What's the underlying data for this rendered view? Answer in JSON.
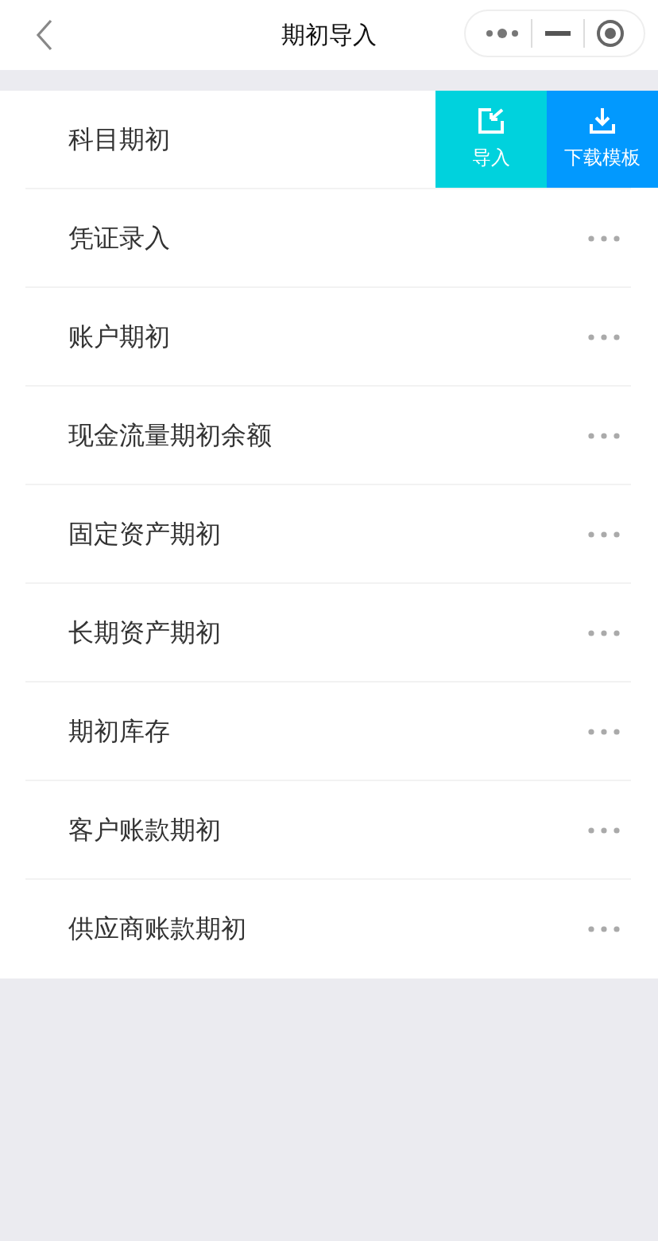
{
  "nav": {
    "title": "期初导入"
  },
  "items": [
    {
      "label": "科目期初",
      "swiped": true,
      "actions": [
        {
          "label": "导入",
          "kind": "import"
        },
        {
          "label": "下载模板",
          "kind": "download"
        }
      ]
    },
    {
      "label": "凭证录入",
      "swiped": false
    },
    {
      "label": "账户期初",
      "swiped": false
    },
    {
      "label": "现金流量期初余额",
      "swiped": false
    },
    {
      "label": "固定资产期初",
      "swiped": false
    },
    {
      "label": "长期资产期初",
      "swiped": false
    },
    {
      "label": "期初库存",
      "swiped": false
    },
    {
      "label": "客户账款期初",
      "swiped": false
    },
    {
      "label": "供应商账款期初",
      "swiped": false
    }
  ]
}
